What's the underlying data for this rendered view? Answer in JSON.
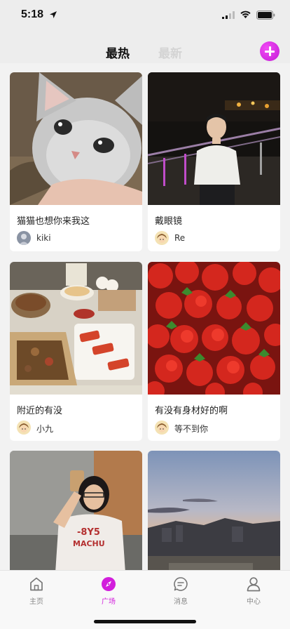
{
  "status_bar": {
    "time": "5:18"
  },
  "header": {
    "tabs": [
      {
        "label": "最热",
        "active": true
      },
      {
        "label": "最新",
        "active": false
      }
    ],
    "accent_color": "#d21edc"
  },
  "feed": {
    "posts": [
      {
        "title": "猫猫也想你来我这",
        "author": "kiki"
      },
      {
        "title": "戴眼镜",
        "author": "Re"
      },
      {
        "title": "附近的有没",
        "author": "小九"
      },
      {
        "title": "有没有身材好的啊",
        "author": "等不到你"
      },
      {
        "title": "",
        "author": ""
      },
      {
        "title": "",
        "author": ""
      }
    ]
  },
  "tab_bar": {
    "items": [
      {
        "label": "主页",
        "icon": "home-icon"
      },
      {
        "label": "广场",
        "icon": "compass-icon",
        "active": true
      },
      {
        "label": "消息",
        "icon": "message-icon"
      },
      {
        "label": "中心",
        "icon": "profile-icon"
      }
    ]
  }
}
